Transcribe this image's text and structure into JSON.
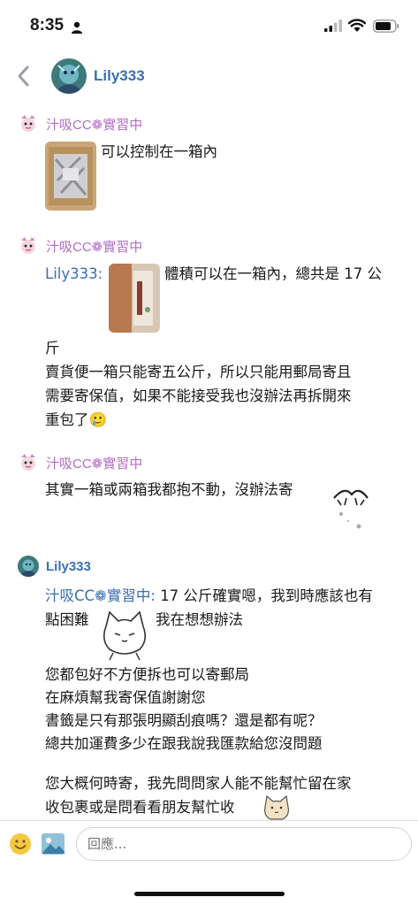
{
  "status_bar": {
    "time": "8:35"
  },
  "header": {
    "title": "Lily333"
  },
  "messages": [
    {
      "sender": "汁吸CC❁實習中",
      "text": "可以控制在一箱內"
    },
    {
      "sender": "汁吸CC❁實習中",
      "quote_name": "Lily333:",
      "quote_text": "體積可以在一箱內，總共是 17 公",
      "lines": [
        "斤",
        "賣貨便一箱只能寄五公斤，所以只能用郵局寄且",
        "需要寄保值，如果不能接受我也沒辦法再拆開來",
        "重包了🥲"
      ]
    },
    {
      "sender": "汁吸CC❁實習中",
      "text": "其實一箱或兩箱我都抱不動，沒辦法寄"
    },
    {
      "sender": "Lily333",
      "quote_name": "汁吸CC❁實習中:",
      "quote_text": "17 公斤確實嗯，我到時應該也有",
      "line2_left": "點困難",
      "line2_right": "我在想想辦法",
      "paragraph1": [
        "您都包好不方便拆也可以寄郵局",
        "在麻煩幫我寄保值謝謝您",
        "書籤是只有那張明顯刮痕嗎？還是都有呢？",
        "總共加運費多少在跟我說我匯款給您沒問題"
      ],
      "paragraph2": [
        "您大概何時寄，我先問問家人能不能幫忙留在家",
        "收包裹或是問看看朋友幫忙收"
      ]
    }
  ],
  "input": {
    "placeholder": "回應..."
  },
  "colors": {
    "accent_blue": "#3a6fb0",
    "sender_purple": "#b36bc6"
  },
  "icons": [
    "person-icon",
    "signal-icon",
    "wifi-icon",
    "battery-icon",
    "back-chevron-icon",
    "emoji-icon",
    "photo-icon"
  ]
}
